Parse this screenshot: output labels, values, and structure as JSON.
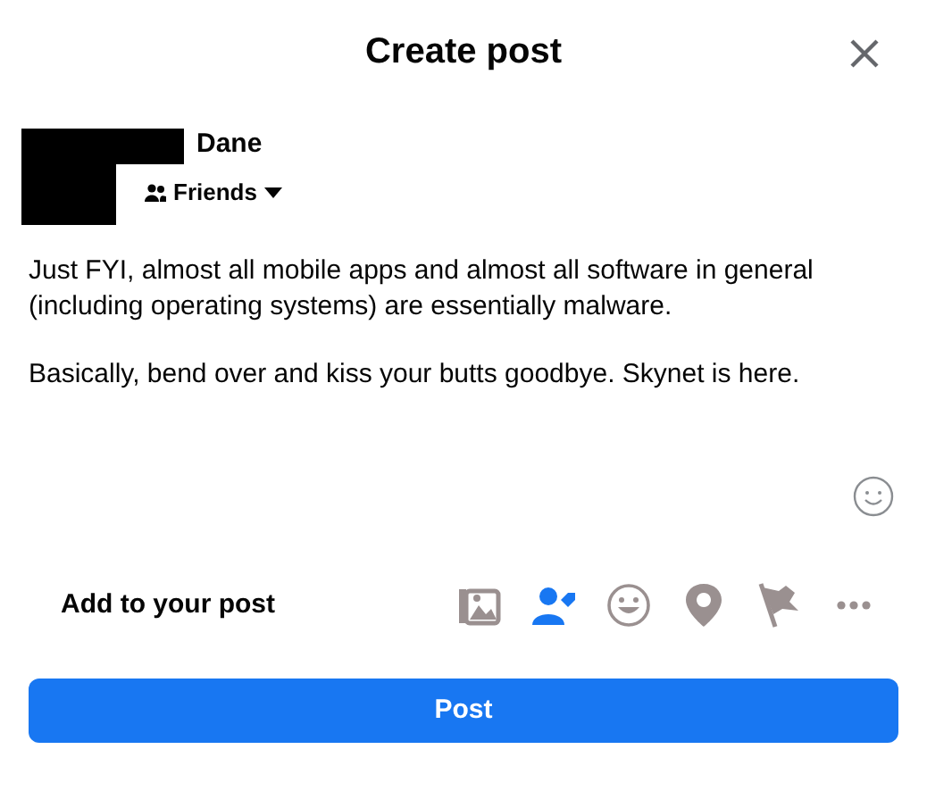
{
  "dialog": {
    "title": "Create post"
  },
  "author": {
    "name": "Dane",
    "audience": "Friends"
  },
  "post": {
    "paragraphs": [
      "Just FYI, almost all mobile apps and almost all software in general (including operating systems) are essentially malware.",
      "Basically, bend over and kiss your butts goodbye. Skynet is here."
    ]
  },
  "add_to_post": {
    "label": "Add to your post",
    "tools": [
      {
        "kind": "photo",
        "selected": false
      },
      {
        "kind": "tag",
        "selected": true
      },
      {
        "kind": "feeling",
        "selected": false
      },
      {
        "kind": "location",
        "selected": false
      },
      {
        "kind": "flag",
        "selected": false
      },
      {
        "kind": "more",
        "selected": false
      }
    ]
  },
  "submit": "Post"
}
